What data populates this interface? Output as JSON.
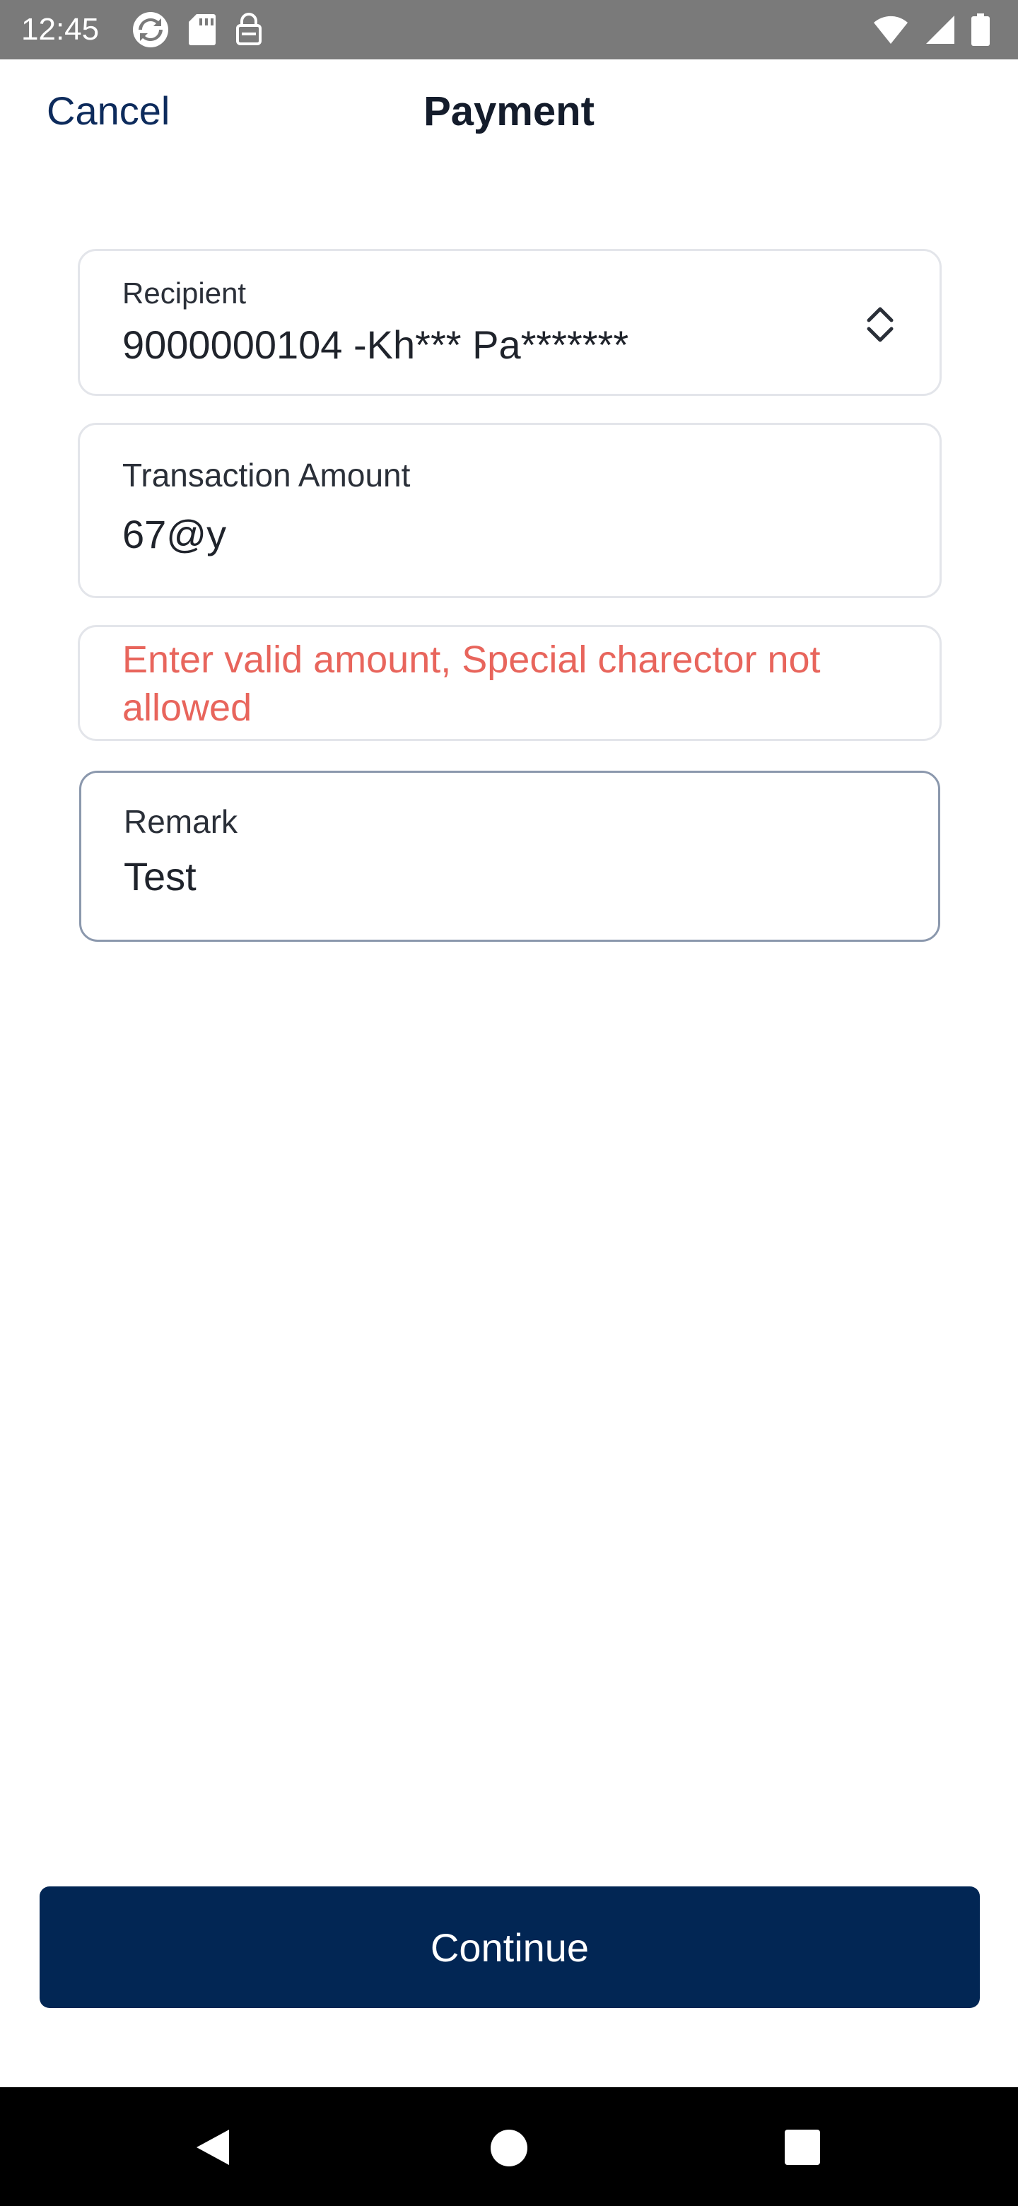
{
  "status_bar": {
    "time": "12:45",
    "left_icons": [
      "sync-icon",
      "sd-card-icon",
      "vpn-key-icon"
    ],
    "right_icons": [
      "wifi-icon",
      "signal-icon",
      "battery-icon"
    ]
  },
  "header": {
    "cancel_label": "Cancel",
    "title": "Payment"
  },
  "form": {
    "recipient": {
      "label": "Recipient",
      "value": "9000000104 -Kh*** Pa*******"
    },
    "amount": {
      "label": "Transaction Amount",
      "value": "67@y"
    },
    "error_message": "Enter valid amount, Special charector not allowed",
    "remark": {
      "label": "Remark",
      "value": "Test"
    }
  },
  "actions": {
    "continue_label": "Continue"
  },
  "colors": {
    "brand": "#022654",
    "link": "#0d2b5c",
    "error": "#e8655c",
    "status_bar": "#7a7a7a"
  },
  "nav": {
    "buttons": [
      "back-icon",
      "home-icon",
      "recents-icon"
    ]
  }
}
